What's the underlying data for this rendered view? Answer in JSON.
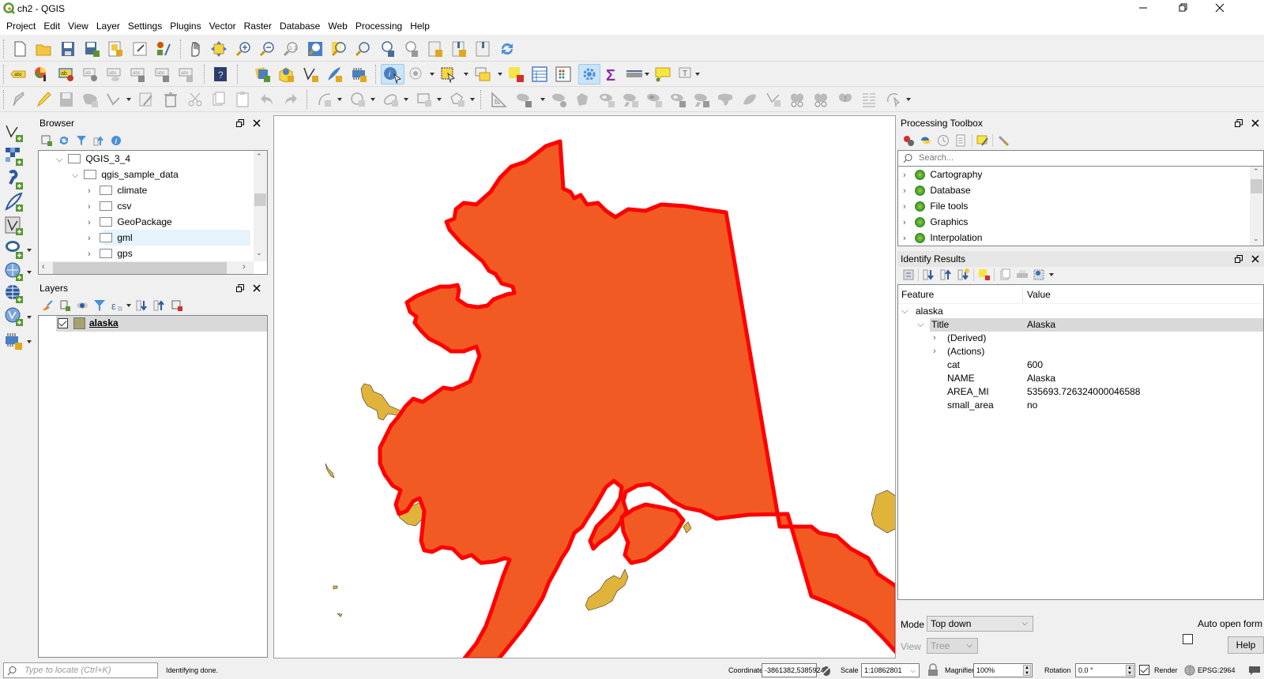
{
  "window": {
    "title": "ch2 - QGIS",
    "minimize_icon": "minimize-icon",
    "restore_icon": "restore-icon",
    "close_icon": "close-icon"
  },
  "menubar": [
    {
      "label": "Project"
    },
    {
      "label": "Edit"
    },
    {
      "label": "View"
    },
    {
      "label": "Layer"
    },
    {
      "label": "Settings"
    },
    {
      "label": "Plugins"
    },
    {
      "label": "Vector"
    },
    {
      "label": "Raster"
    },
    {
      "label": "Database"
    },
    {
      "label": "Web"
    },
    {
      "label": "Processing"
    },
    {
      "label": "Help"
    }
  ],
  "toolbar1": [
    "new-project",
    "open-project",
    "save-project",
    "save-as",
    "new-print-layout",
    "layout-manager",
    "style-manager",
    "pan",
    "pan-to-selection",
    "zoom-in",
    "zoom-out",
    "zoom-native",
    "zoom-full",
    "zoom-to-selection",
    "zoom-to-layer",
    "zoom-last",
    "zoom-next",
    "new-bookmark",
    "show-bookmarks",
    "bookmark",
    "refresh"
  ],
  "toolbar2": [
    "label-tool",
    "diagram-tool",
    "highlight-pinned-labels",
    "pin-labels",
    "show-hide-labels",
    "move-label",
    "rotate-label",
    "change-label",
    "help",
    "data-source-manager",
    "new-geopackage",
    "new-shapefile",
    "new-spatialite",
    "new-temp-scratch",
    "identify-features",
    "action",
    "select-features",
    "select-by-value",
    "deselect",
    "open-attribute-table",
    "field-calculator",
    "toolbox",
    "statistical-summary",
    "measure",
    "map-tips",
    "text-annotation"
  ],
  "toolbar3": [
    "current-edits",
    "toggle-editing",
    "save-layer-edits",
    "add-polygon",
    "vertex-tool",
    "modify-attributes",
    "delete-selected",
    "cut-features",
    "copy-features",
    "paste-features",
    "undo",
    "redo",
    "digitize-curve",
    "digitize-circle",
    "digitize-ellipse",
    "digitize-rectangle",
    "digitize-polygon",
    "enable-advanced-digitizing",
    "move-feature",
    "rotate-feature",
    "simplify",
    "add-ring",
    "add-part",
    "fill-ring",
    "delete-ring",
    "delete-part",
    "reshape",
    "offset-curve",
    "reverse-line",
    "split-features",
    "split-parts",
    "merge-features",
    "merge-attributes",
    "rotate-point-symbols"
  ],
  "left_toolbar": [
    "add-vector-layer",
    "add-raster-layer",
    "add-delimited-text",
    "add-spatialite",
    "add-virtual-layer",
    "add-postgis",
    "add-wms",
    "add-wcs",
    "add-wfs",
    "add-mesh"
  ],
  "browser": {
    "title": "Browser",
    "toolbar": [
      "add-selected-icon",
      "refresh-icon",
      "filter-icon",
      "collapse-all-icon",
      "info-icon"
    ],
    "items": [
      {
        "label": "QGIS_3_4",
        "expanded": true,
        "level": 0
      },
      {
        "label": "qgis_sample_data",
        "expanded": true,
        "level": 1
      },
      {
        "label": "climate",
        "expanded": false,
        "level": 2
      },
      {
        "label": "csv",
        "expanded": false,
        "level": 2
      },
      {
        "label": "GeoPackage",
        "expanded": false,
        "level": 2
      },
      {
        "label": "gml",
        "expanded": false,
        "level": 2,
        "highlighted": true
      },
      {
        "label": "gps",
        "expanded": false,
        "level": 2
      }
    ]
  },
  "layers": {
    "title": "Layers",
    "items": [
      {
        "label": "alaska",
        "checked": true,
        "color": "#a4a36b",
        "selected": true
      }
    ]
  },
  "processing_toolbox": {
    "title": "Processing Toolbox",
    "search_placeholder": "Search...",
    "items": [
      {
        "label": "Cartography"
      },
      {
        "label": "Database"
      },
      {
        "label": "File tools"
      },
      {
        "label": "Graphics"
      },
      {
        "label": "Interpolation"
      }
    ]
  },
  "identify_results": {
    "title": "Identify Results",
    "col_feature": "Feature",
    "col_value": "Value",
    "layer": "alaska",
    "title_row": {
      "label": "Title",
      "value": "Alaska"
    },
    "groups": [
      {
        "label": "(Derived)"
      },
      {
        "label": "(Actions)"
      }
    ],
    "attributes": [
      {
        "name": "cat",
        "value": "600"
      },
      {
        "name": "NAME",
        "value": "Alaska"
      },
      {
        "name": "AREA_MI",
        "value": "535693.726324000046588"
      },
      {
        "name": "small_area",
        "value": "no"
      }
    ],
    "mode_label": "Mode",
    "mode_value": "Top down",
    "view_label": "View",
    "view_value": "Tree",
    "auto_open_label": "Auto open form",
    "auto_open_checked": false,
    "help_label": "Help"
  },
  "map": {
    "fill_color": "#f15a22",
    "outline_color": "#ff0000",
    "island_color": "#e0b33b"
  },
  "statusbar": {
    "locate_placeholder": "Type to locate (Ctrl+K)",
    "message": "Identifying done.",
    "coordinate_label": "Coordinate",
    "coordinate_value": "-3861382,5385924",
    "scale_label": "Scale",
    "scale_value": "1:10862801",
    "magnifier_label": "Magnifier",
    "magnifier_value": "100%",
    "rotation_label": "Rotation",
    "rotation_value": "0.0 °",
    "render_label": "Render",
    "render_checked": true,
    "crs_label": "EPSG:2964"
  }
}
